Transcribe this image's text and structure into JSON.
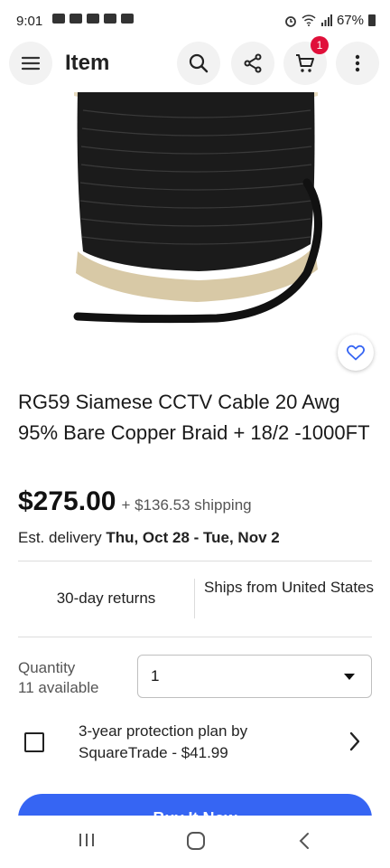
{
  "status": {
    "time": "9:01",
    "battery": "67%"
  },
  "appbar": {
    "title": "Item",
    "cart_count": "1"
  },
  "item": {
    "title": "RG59 Siamese CCTV Cable 20 Awg 95% Bare Copper Braid + 18/2 -1000FT",
    "price": "$275.00",
    "shipping": "+ $136.53 shipping",
    "delivery_label": "Est. delivery",
    "delivery_dates": "Thu, Oct 28 - Tue, Nov 2",
    "returns": "30-day returns",
    "ships_from": "Ships from United States",
    "quantity_label": "Quantity",
    "available": "11 available",
    "quantity_value": "1",
    "protection": "3-year protection plan by SquareTrade - $41.99",
    "buy_label": "Buy It Now"
  },
  "colors": {
    "accent": "#3665f3",
    "badge": "#e0103a"
  }
}
